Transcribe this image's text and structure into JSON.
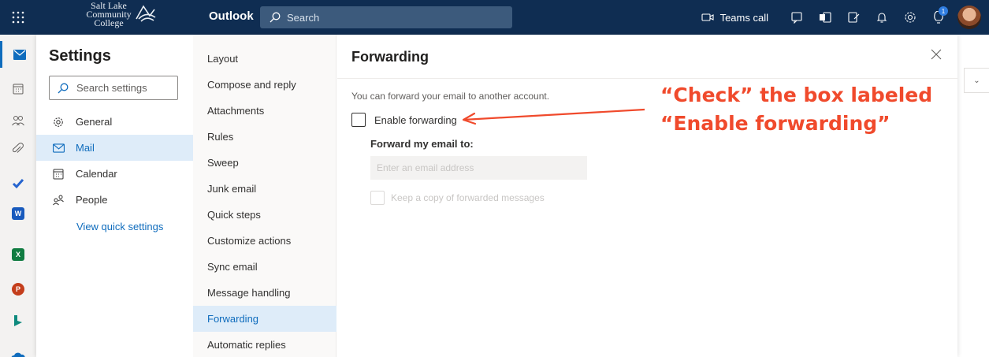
{
  "topbar": {
    "logo_text": "Salt Lake Community College",
    "app_name": "Outlook",
    "search_placeholder": "Search",
    "teams_call": "Teams call",
    "notification_count": "1"
  },
  "settings": {
    "title": "Settings",
    "search_placeholder": "Search settings",
    "categories": [
      {
        "label": "General",
        "icon": "gear-icon"
      },
      {
        "label": "Mail",
        "icon": "mail-icon"
      },
      {
        "label": "Calendar",
        "icon": "calendar-icon"
      },
      {
        "label": "People",
        "icon": "people-icon"
      }
    ],
    "active_category": "Mail",
    "quick_settings": "View quick settings"
  },
  "mail_nav": {
    "items": [
      "Layout",
      "Compose and reply",
      "Attachments",
      "Rules",
      "Sweep",
      "Junk email",
      "Quick steps",
      "Customize actions",
      "Sync email",
      "Message handling",
      "Forwarding",
      "Automatic replies"
    ],
    "active": "Forwarding"
  },
  "forwarding": {
    "title": "Forwarding",
    "description": "You can forward your email to another account.",
    "enable_label": "Enable forwarding",
    "enable_checked": false,
    "forward_to_label": "Forward my email to:",
    "email_placeholder": "Enter an email address",
    "keep_copy_label": "Keep a copy of forwarded messages",
    "keep_copy_checked": false
  },
  "annotation": {
    "line1": "“Check” the box labeled",
    "line2": "“Enable forwarding”",
    "color": "#f04a2c"
  },
  "colors": {
    "header": "#0f2d52",
    "accent": "#0f6cbd",
    "selected_bg": "#deecf9"
  }
}
